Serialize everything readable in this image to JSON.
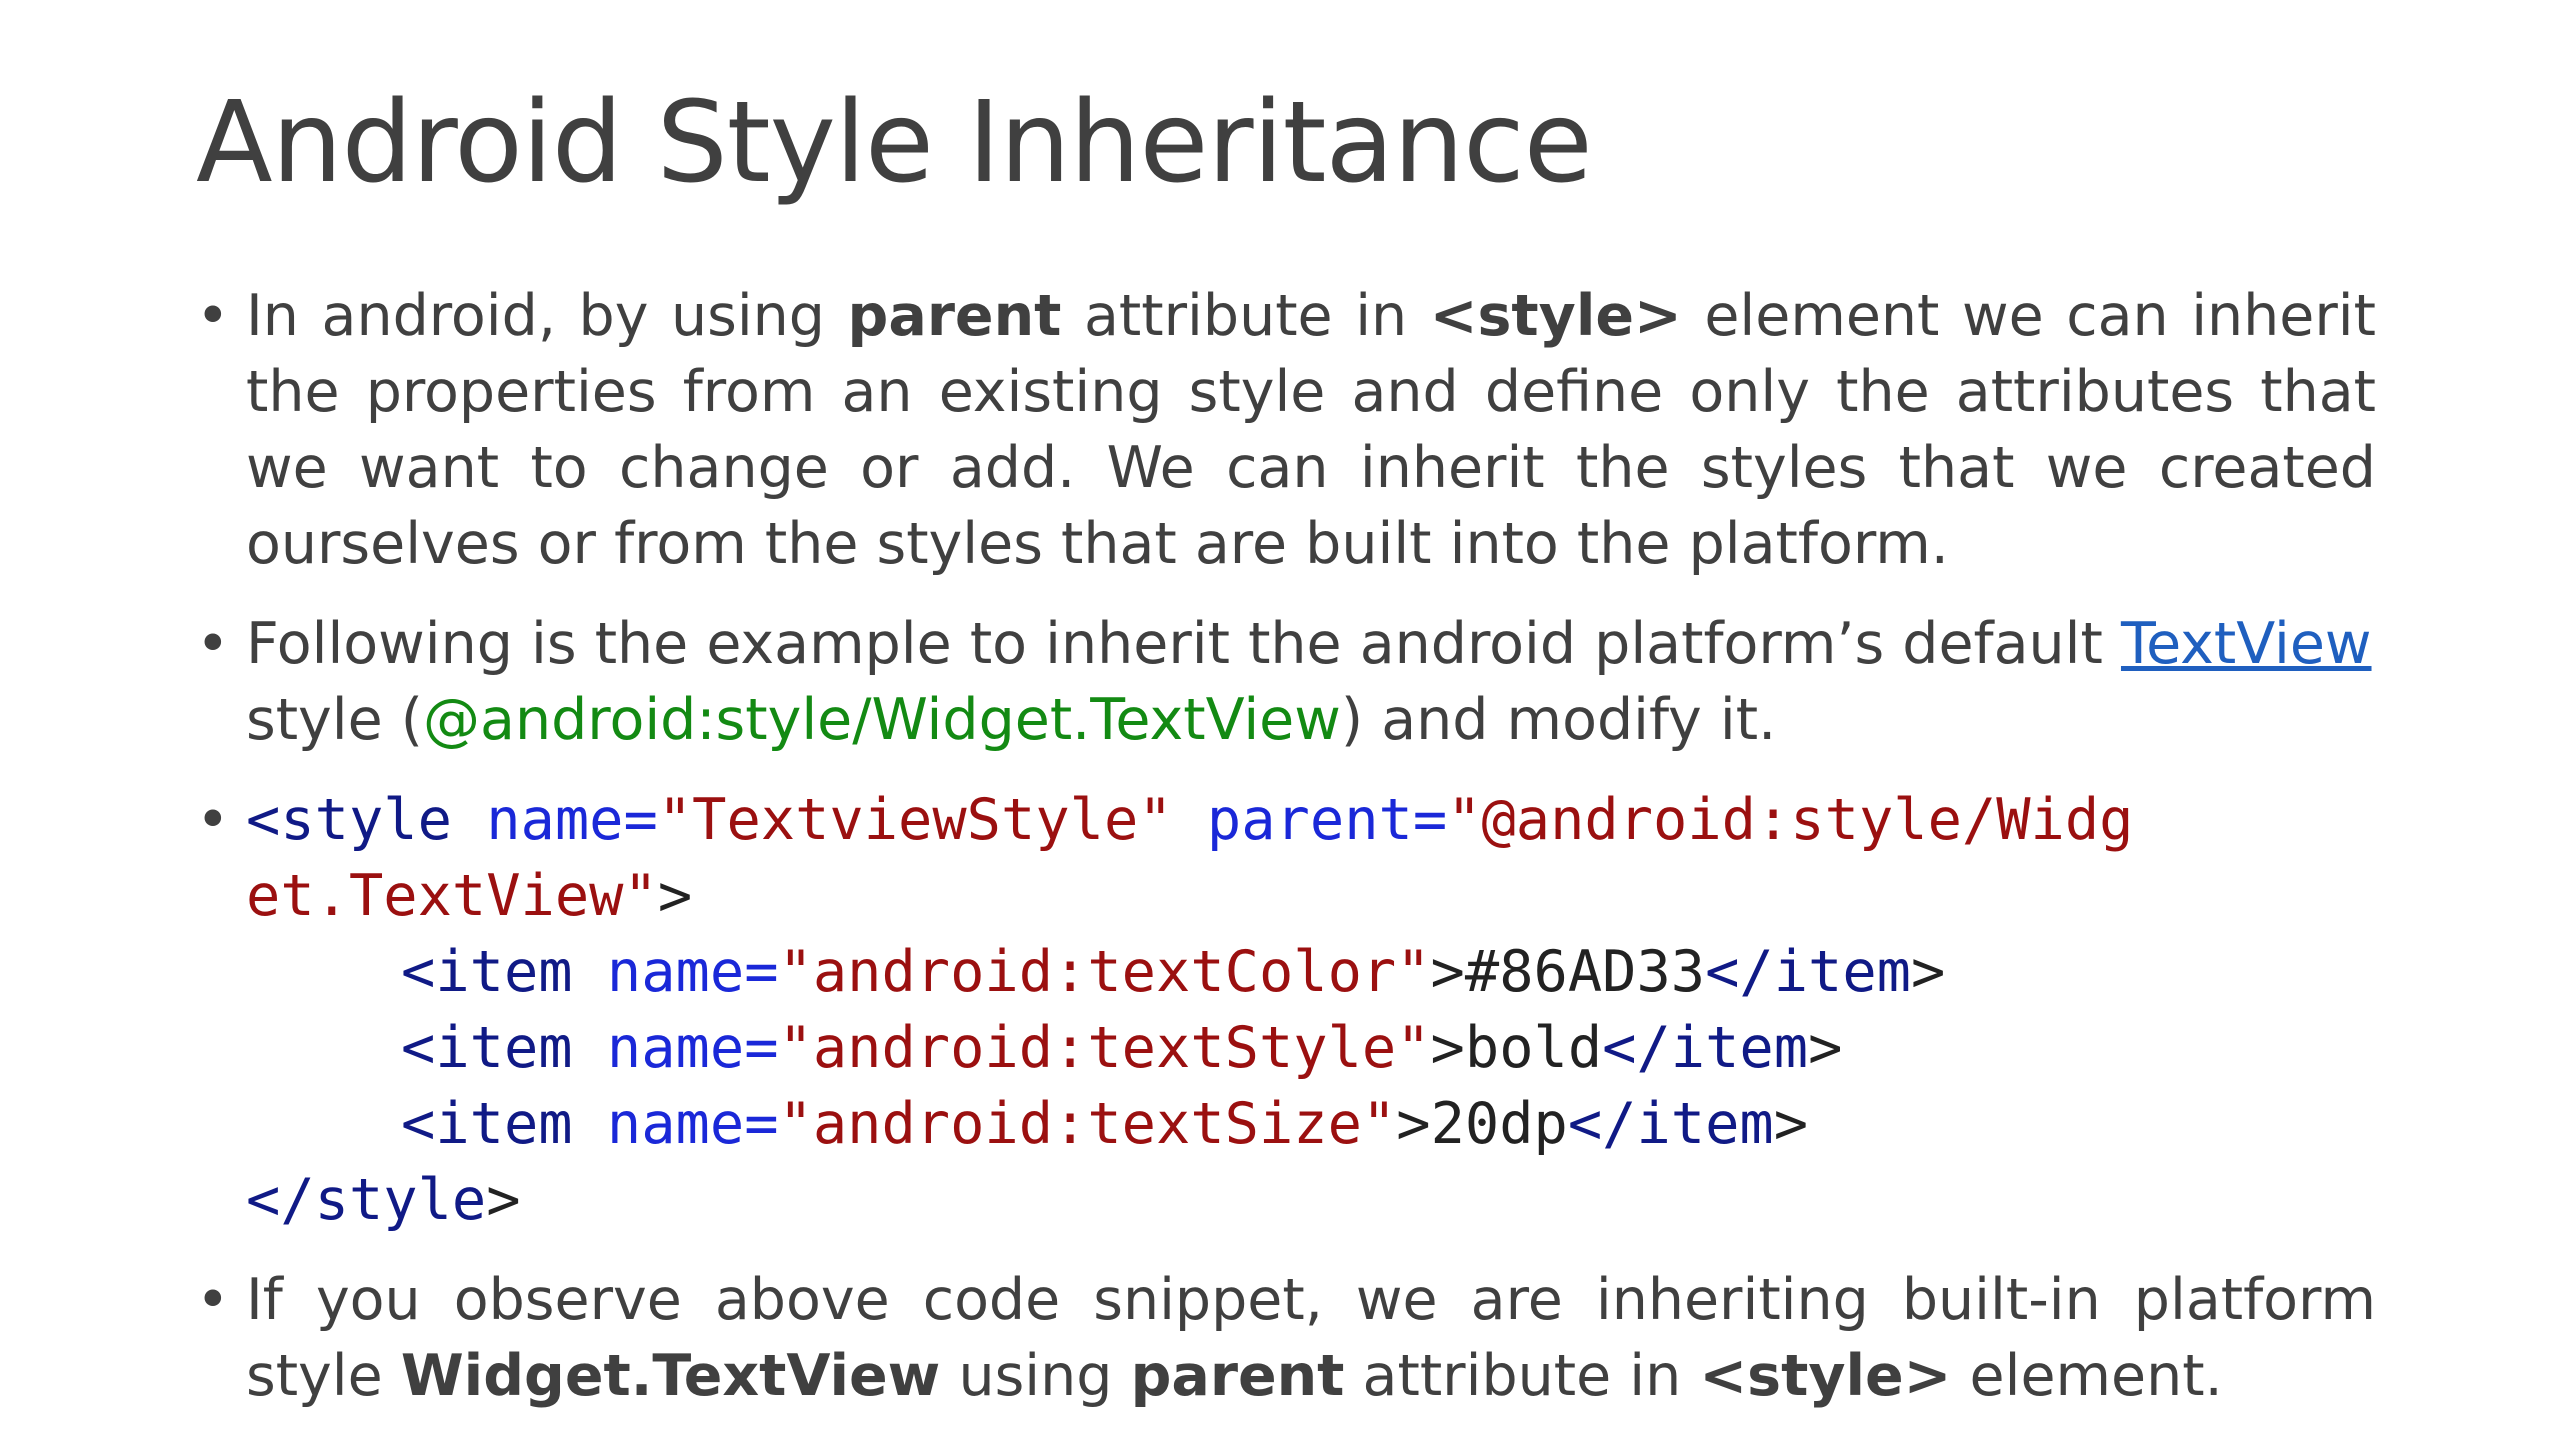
{
  "slide": {
    "title": "Android Style Inheritance",
    "bullets": {
      "b1": {
        "t1": "In android, by using ",
        "t2": "parent",
        "t3": " attribute in ",
        "t4": "<style>",
        "t5": " element we can inherit the properties from an existing style and define only the attributes that we want to change or add. We can inherit the styles that we created ourselves or from the styles that are built into the platform."
      },
      "b2": {
        "t1": " Following is the example to inherit the android platform’s default ",
        "link": "TextView",
        "t2": " style (",
        "green": "@android:style/Widget.TextView",
        "t3": ") and modify it."
      },
      "b3": {
        "l1_open": "<style",
        "l1_attr1": "name=",
        "l1_val1": "\"TextviewStyle\"",
        "l1_attr2": "parent=",
        "l1_val2a": "\"@android:style/Widg",
        "l2_val2b": "et.TextView\"",
        "l2_close": ">",
        "items": [
          {
            "open": "<item",
            "attr": "name=",
            "val": "\"android:textColor\"",
            "gt": ">",
            "text": "#86AD33",
            "close": "</item",
            "end": ">"
          },
          {
            "open": "<item",
            "attr": "name=",
            "val": "\"android:textStyle\"",
            "gt": ">",
            "text": "bold",
            "close": "</item",
            "end": ">"
          },
          {
            "open": "<item",
            "attr": "name=",
            "val": "\"android:textSize\"",
            "gt": ">",
            "text": "20dp",
            "close": "</item",
            "end": ">"
          }
        ],
        "end_open": "</style",
        "end_close": ">"
      },
      "b4": {
        "t1": "If you observe above code snippet, we are inheriting built-in platform style ",
        "t2": "Widget.TextView",
        "t3": " using ",
        "t4": "parent",
        "t5": " attribute in ",
        "t6": "<style>",
        "t7": " element."
      }
    },
    "bullet_char": "•",
    "colors": {
      "text": "#404040",
      "link": "#1f5fbf",
      "green": "#138a13",
      "code_tag": "#101a86",
      "code_attr": "#1a28d8",
      "code_string": "#9b1010"
    }
  }
}
